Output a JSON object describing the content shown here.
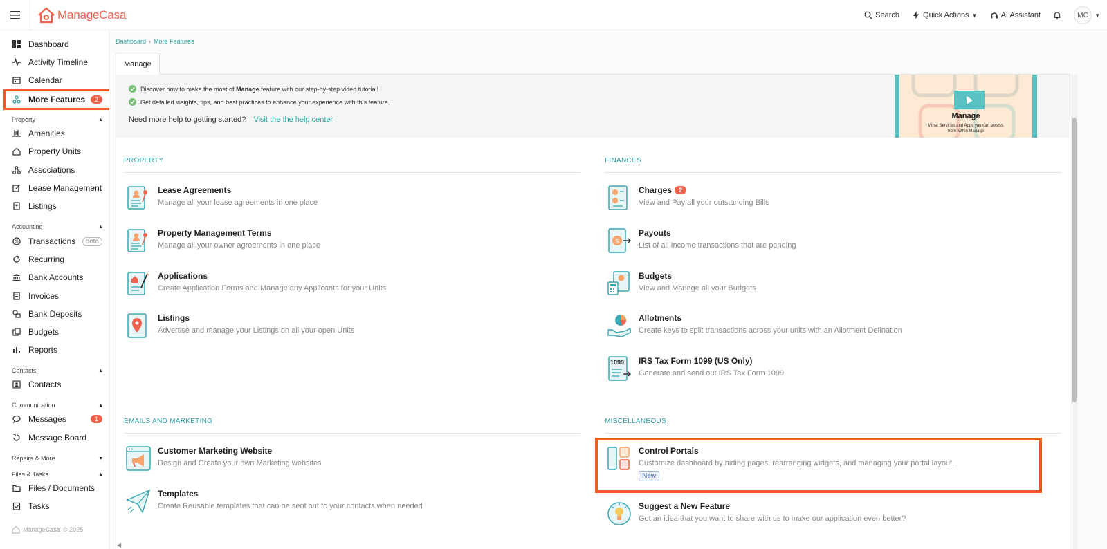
{
  "app": {
    "logo_text_a": "Manage",
    "logo_text_b": "Casa",
    "brand_color": "#f0624d",
    "accent_color": "#2aa6a0",
    "highlight_color": "#f35a1b"
  },
  "topbar": {
    "search": "Search",
    "quick_actions": "Quick Actions",
    "ai_assistant": "AI Assistant",
    "avatar": "MC"
  },
  "sidebar": {
    "top": [
      {
        "label": "Dashboard",
        "icon": "dashboard-icon"
      },
      {
        "label": "Activity Timeline",
        "icon": "activity-icon"
      },
      {
        "label": "Calendar",
        "icon": "calendar-icon"
      },
      {
        "label": "More Features",
        "icon": "features-icon",
        "badge": "2"
      }
    ],
    "property_title": "Property",
    "property": [
      {
        "label": "Amenities",
        "icon": "amenities-icon"
      },
      {
        "label": "Property Units",
        "icon": "home-icon"
      },
      {
        "label": "Associations",
        "icon": "associations-icon"
      },
      {
        "label": "Lease Management",
        "icon": "edit-icon"
      },
      {
        "label": "Listings",
        "icon": "listings-icon"
      }
    ],
    "accounting_title": "Accounting",
    "accounting": [
      {
        "label": "Transactions",
        "icon": "dollar-icon",
        "tag": "beta"
      },
      {
        "label": "Recurring",
        "icon": "recurring-icon"
      },
      {
        "label": "Bank Accounts",
        "icon": "bank-icon"
      },
      {
        "label": "Invoices",
        "icon": "invoice-icon"
      },
      {
        "label": "Bank Deposits",
        "icon": "deposit-icon"
      },
      {
        "label": "Budgets",
        "icon": "budget-icon"
      },
      {
        "label": "Reports",
        "icon": "chart-icon"
      }
    ],
    "contacts_title": "Contacts",
    "contacts": [
      {
        "label": "Contacts",
        "icon": "contacts-icon"
      }
    ],
    "communication_title": "Communication",
    "communication": [
      {
        "label": "Messages",
        "icon": "message-icon",
        "badge": "1"
      },
      {
        "label": "Message Board",
        "icon": "board-icon"
      }
    ],
    "repairs_title": "Repairs & More",
    "files_title": "Files & Tasks",
    "files": [
      {
        "label": "Files / Documents",
        "icon": "folder-icon"
      },
      {
        "label": "Tasks",
        "icon": "tasks-icon"
      }
    ],
    "footer_a": "Manage",
    "footer_b": "Casa",
    "footer_c": "© 2025"
  },
  "breadcrumb": {
    "items": [
      "Dashboard",
      "More Features"
    ],
    "sep": "›"
  },
  "tab": "Manage",
  "banner": {
    "line1_pre": "Discover how to make the most of ",
    "line1_bold": "Manage",
    "line1_post": " feature with our step-by-step video tutorial!",
    "line2": "Get detailed insights, tips, and best practices to enhance your experience with this feature.",
    "help": "Need more help to getting started?",
    "help_link": "Visit the the help center",
    "video_title": "Manage",
    "video_sub": "What Services and Apps you can access from within Manage"
  },
  "sections": {
    "property": {
      "title": "PROPERTY",
      "items": [
        {
          "title": "Lease Agreements",
          "desc": "Manage all your lease agreements in one place"
        },
        {
          "title": "Property Management Terms",
          "desc": "Manage all your owner agreements in one place"
        },
        {
          "title": "Applications",
          "desc": "Create Application Forms and Manage any Applicants for your Units"
        },
        {
          "title": "Listings",
          "desc": "Advertise and manage your Listings on all your open Units"
        }
      ]
    },
    "finances": {
      "title": "FINANCES",
      "items": [
        {
          "title": "Charges",
          "desc": "View and Pay all your outstanding Bills",
          "badge": "2"
        },
        {
          "title": "Payouts",
          "desc": "List of all Income transactions that are pending"
        },
        {
          "title": "Budgets",
          "desc": "View and Manage all your Budgets"
        },
        {
          "title": "Allotments",
          "desc": "Create keys to split transactions across your units with an Allotment Defination"
        },
        {
          "title": "IRS Tax Form 1099 (US Only)",
          "desc": "Generate and send out IRS Tax Form 1099",
          "icon_text": "1099"
        }
      ]
    },
    "emails": {
      "title": "EMAILS AND MARKETING",
      "items": [
        {
          "title": "Customer Marketing Website",
          "desc": "Design and Create your own Marketing websites"
        },
        {
          "title": "Templates",
          "desc": "Create Reusable templates that can be sent out to your contacts when needed"
        }
      ]
    },
    "misc": {
      "title": "MISCELLANEOUS",
      "items": [
        {
          "title": "Control Portals",
          "desc": "Customize dashboard by hiding pages, rearranging widgets, and managing your portal layout.",
          "tag": "New"
        },
        {
          "title": "Suggest a New Feature",
          "desc": "Got an idea that you want to share with us to make our application even better?"
        }
      ]
    }
  }
}
